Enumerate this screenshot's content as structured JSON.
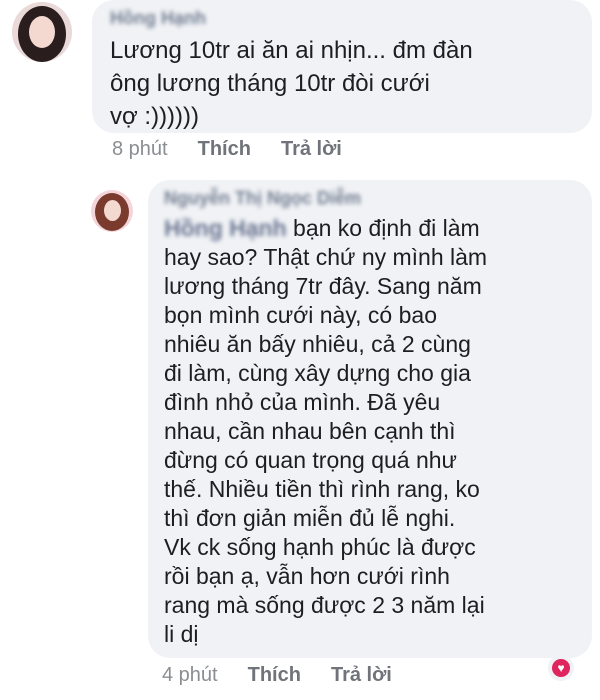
{
  "comment1": {
    "author": "Hồng Hạnh",
    "text": "Lương 10tr ai ăn ai nhịn... đm đàn\nông lương tháng 10tr đòi cưới\nvợ :))))))",
    "time": "8 phút",
    "like_label": "Thích",
    "reply_label": "Trả lời"
  },
  "comment2": {
    "author": "Nguyễn Thị Ngọc Diễm",
    "mention": "Hồng Hạnh",
    "text": " bạn ko định đi làm\nhay sao? Thật chứ ny mình làm\nlương tháng 7tr đây. Sang năm\nbọn mình cưới này, có bao\nnhiêu ăn bấy nhiêu, cả 2 cùng\nđi làm, cùng xây dựng cho gia\nđình nhỏ của mình. Đã yêu\nnhau, cần nhau bên cạnh thì\nđừng có quan trọng quá như\nthế. Nhiều tiền thì rình rang, ko\nthì đơn giản miễn đủ lễ nghi.\nVk ck sống hạnh phúc là được\nrồi bạn ạ, vẫn hơn cưới rình\nrang mà sống được 2 3 năm lại\nli dị",
    "time": "4 phút",
    "like_label": "Thích",
    "reply_label": "Trả lời",
    "reaction_count": "1",
    "reaction_icon": "heart-icon"
  }
}
